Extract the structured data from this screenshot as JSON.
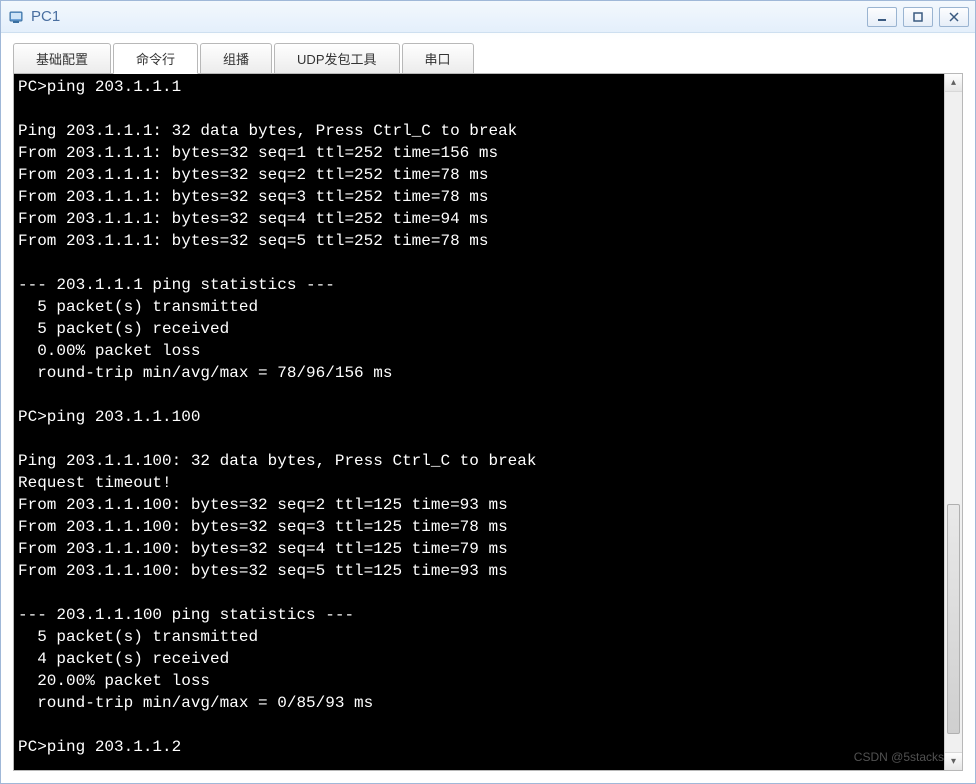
{
  "window": {
    "title": "PC1"
  },
  "tabs": [
    {
      "label": "基础配置",
      "active": false
    },
    {
      "label": "命令行",
      "active": true
    },
    {
      "label": "组播",
      "active": false
    },
    {
      "label": "UDP发包工具",
      "active": false
    },
    {
      "label": "串口",
      "active": false
    }
  ],
  "terminal": {
    "lines": [
      "PC>ping 203.1.1.1",
      "",
      "Ping 203.1.1.1: 32 data bytes, Press Ctrl_C to break",
      "From 203.1.1.1: bytes=32 seq=1 ttl=252 time=156 ms",
      "From 203.1.1.1: bytes=32 seq=2 ttl=252 time=78 ms",
      "From 203.1.1.1: bytes=32 seq=3 ttl=252 time=78 ms",
      "From 203.1.1.1: bytes=32 seq=4 ttl=252 time=94 ms",
      "From 203.1.1.1: bytes=32 seq=5 ttl=252 time=78 ms",
      "",
      "--- 203.1.1.1 ping statistics ---",
      "  5 packet(s) transmitted",
      "  5 packet(s) received",
      "  0.00% packet loss",
      "  round-trip min/avg/max = 78/96/156 ms",
      "",
      "PC>ping 203.1.1.100",
      "",
      "Ping 203.1.1.100: 32 data bytes, Press Ctrl_C to break",
      "Request timeout!",
      "From 203.1.1.100: bytes=32 seq=2 ttl=125 time=93 ms",
      "From 203.1.1.100: bytes=32 seq=3 ttl=125 time=78 ms",
      "From 203.1.1.100: bytes=32 seq=4 ttl=125 time=79 ms",
      "From 203.1.1.100: bytes=32 seq=5 ttl=125 time=93 ms",
      "",
      "--- 203.1.1.100 ping statistics ---",
      "  5 packet(s) transmitted",
      "  4 packet(s) received",
      "  20.00% packet loss",
      "  round-trip min/avg/max = 0/85/93 ms",
      "",
      "PC>ping 203.1.1.2"
    ]
  },
  "watermark": "CSDN @5stacks"
}
